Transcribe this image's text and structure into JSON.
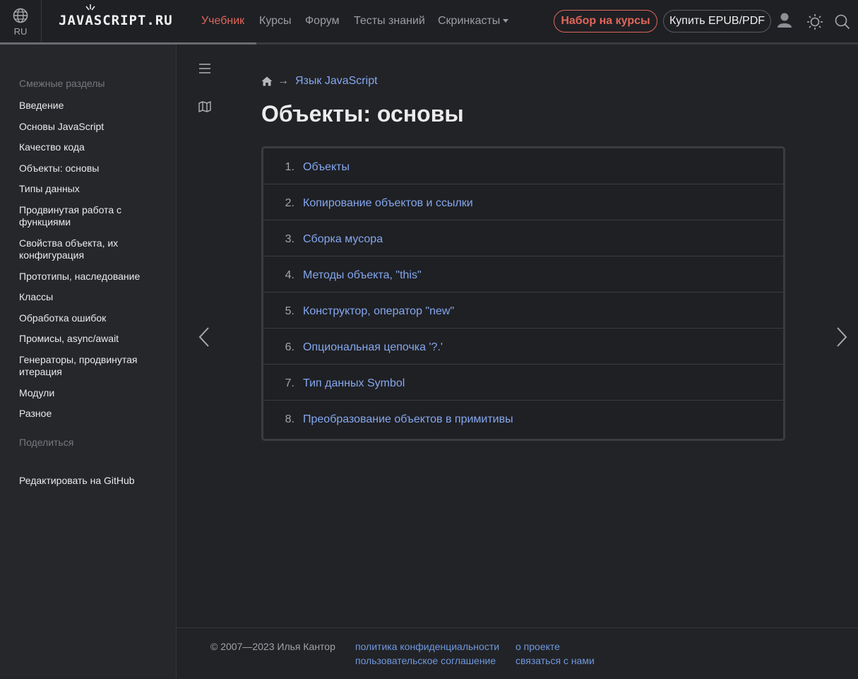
{
  "header": {
    "lang": "RU",
    "logo": "JAVASCRIPT.RU",
    "nav": [
      {
        "label": "Учебник",
        "active": true
      },
      {
        "label": "Курсы"
      },
      {
        "label": "Форум"
      },
      {
        "label": "Тесты знаний"
      },
      {
        "label": "Скринкасты"
      }
    ],
    "courses_button": "Набор на курсы",
    "buy_button": "Купить EPUB/PDF"
  },
  "sidebar": {
    "related_heading": "Смежные разделы",
    "items": [
      "Введение",
      "Основы JavaScript",
      "Качество кода",
      "Объекты: основы",
      "Типы данных",
      "Продвинутая работа с функциями",
      "Свойства объекта, их конфигурация",
      "Прототипы, наследование",
      "Классы",
      "Обработка ошибок",
      "Промисы, async/await",
      "Генераторы, продвинутая итерация",
      "Модули",
      "Разное"
    ],
    "share_heading": "Поделиться",
    "edit_link": "Редактировать на GitHub"
  },
  "breadcrumb": {
    "arrow": "→",
    "link": "Язык JavaScript"
  },
  "page_title": "Объекты: основы",
  "toc": [
    {
      "num": "1.",
      "label": "Объекты"
    },
    {
      "num": "2.",
      "label": "Копирование объектов и ссылки"
    },
    {
      "num": "3.",
      "label": "Сборка мусора"
    },
    {
      "num": "4.",
      "label": "Методы объекта, \"this\""
    },
    {
      "num": "5.",
      "label": "Конструктор, оператор \"new\""
    },
    {
      "num": "6.",
      "label": "Опциональная цепочка '?.'"
    },
    {
      "num": "7.",
      "label": "Тип данных Symbol"
    },
    {
      "num": "8.",
      "label": "Преобразование объектов в примитивы"
    }
  ],
  "footer": {
    "copyright": "© 2007—2023  Илья Кантор",
    "privacy": "политика конфиденциальности",
    "terms": "пользовательское соглашение",
    "about": "о проекте",
    "contact": "связаться с нами"
  },
  "colors": {
    "accent": "#e0665a",
    "link": "#84a7ee",
    "background": "#222327",
    "sidebar": "#26272b"
  },
  "icons": [
    "globe-icon",
    "user-icon",
    "theme-sun-icon",
    "search-icon",
    "menu-icon",
    "map-icon",
    "home-icon",
    "chevron-left-icon",
    "chevron-right-icon"
  ]
}
